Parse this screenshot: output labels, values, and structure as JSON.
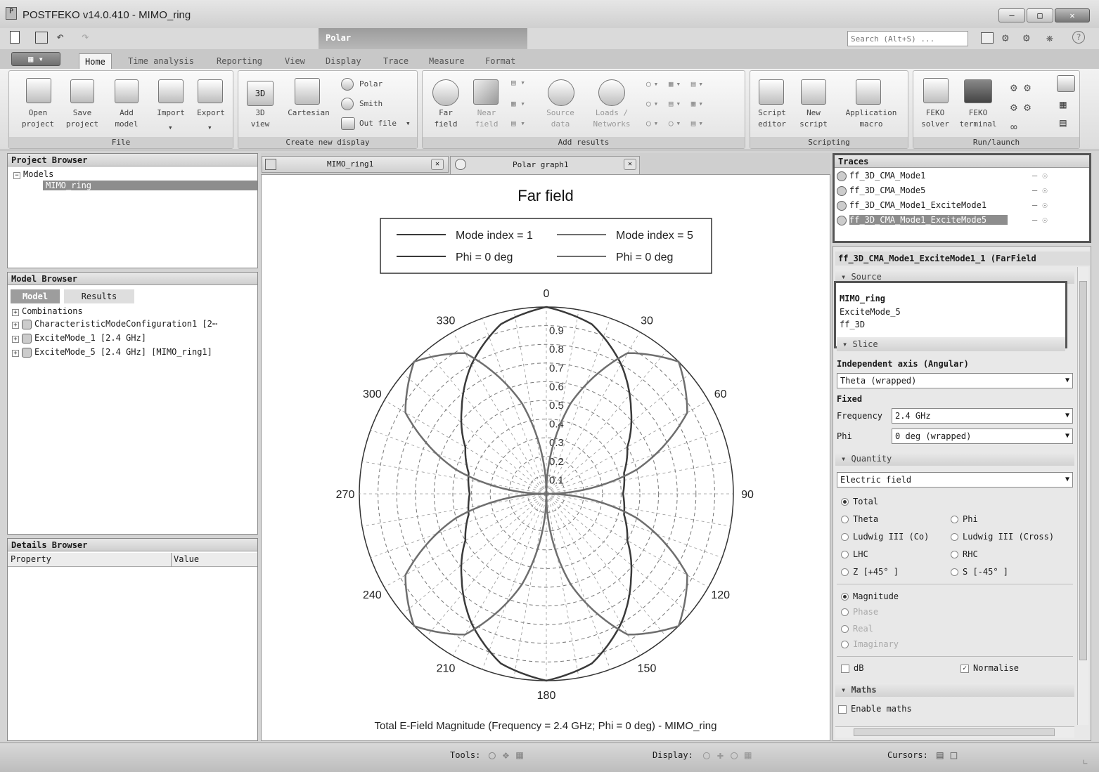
{
  "window": {
    "title": "POSTFEKO v14.0.410 - MIMO_ring",
    "search_placeholder": "Search (Alt+S) ..."
  },
  "contextual_tab": "Polar",
  "tabs": [
    "Home",
    "Time analysis",
    "Reporting",
    "View",
    "Display",
    "Trace",
    "Measure",
    "Format"
  ],
  "ribbon": {
    "file_group": "File",
    "create_group": "Create new display",
    "add_group": "Add results",
    "scripting_group": "Scripting",
    "run_group": "Run/launch",
    "open_project": "Open\nproject",
    "save_project": "Save\nproject",
    "add_model": "Add\nmodel",
    "import": "Import",
    "export": "Export",
    "view3d": "3D\nview",
    "cartesian": "Cartesian",
    "polar": "Polar",
    "smith": "Smith",
    "out_file": "Out file",
    "far_field": "Far\nfield",
    "near_field": "Near\nfield",
    "source_data": "Source\ndata",
    "loads_networks": "Loads /\nNetworks",
    "script_editor": "Script\neditor",
    "new_script": "New\nscript",
    "application_macro": "Application\nmacro",
    "feko_solver": "FEKO\nsolver",
    "feko_terminal": "FEKO\nterminal"
  },
  "project_browser": {
    "title": "Project Browser",
    "root": "Models",
    "child": "MIMO_ring"
  },
  "model_browser": {
    "title": "Model Browser",
    "tab_model": "Model",
    "tab_results": "Results",
    "items": [
      "Combinations",
      "CharacteristicModeConfiguration1 [2⋯",
      "ExciteMode_1 [2.4 GHz]",
      "ExciteMode_5 [2.4 GHz] [MIMO_ring1]"
    ]
  },
  "details_browser": {
    "title": "Details Browser",
    "col_property": "Property",
    "col_value": "Value"
  },
  "doc_tabs": [
    "MIMO_ring1",
    "Polar graph1"
  ],
  "traces": {
    "title": "Traces",
    "items": [
      "ff_3D_CMA_Mode1",
      "ff_3D_CMA_Mode5",
      "ff_3D_CMA_Mode1_ExciteMode1",
      "ff_3D_CMA_Mode1_ExciteMode5"
    ]
  },
  "props": {
    "header": "ff_3D_CMA_Mode1_ExciteMode1_1 (FarField",
    "source_label": "Source",
    "source_lines": [
      "MIMO_ring",
      "ExciteMode_5",
      "ff_3D"
    ],
    "slice_label": "Slice",
    "independent_axis": "Independent axis (Angular)",
    "axis_value": "Theta (wrapped)",
    "fixed": "Fixed",
    "frequency_label": "Frequency",
    "frequency_value": "2.4 GHz",
    "phi_label": "Phi",
    "phi_value": "0 deg (wrapped)",
    "quantity_label": "Quantity",
    "quantity_value": "Electric field",
    "opt_total": "Total",
    "opt_theta": "Theta",
    "opt_phi": "Phi",
    "opt_ludwig_co": "Ludwig III (Co)",
    "opt_ludwig_cross": "Ludwig III (Cross)",
    "opt_lhc": "LHC",
    "opt_rhc": "RHC",
    "opt_z": "Z [+45° ]",
    "opt_s": "S [-45° ]",
    "opt_magnitude": "Magnitude",
    "opt_phase": "Phase",
    "opt_real": "Real",
    "opt_imaginary": "Imaginary",
    "db": "dB",
    "normalise": "Normalise",
    "maths_label": "Maths",
    "enable_maths": "Enable maths"
  },
  "status": {
    "tools": "Tools:",
    "display": "Display:",
    "cursors": "Cursors:"
  },
  "chart_data": {
    "type": "polar",
    "title": "Far field",
    "footer": "Total E-Field Magnitude (Frequency = 2.4 GHz; Phi = 0 deg) - MIMO_ring",
    "angle_ticks": [
      0,
      30,
      60,
      90,
      120,
      150,
      180,
      210,
      240,
      270,
      300,
      330
    ],
    "radial_ticks": [
      0.1,
      0.2,
      0.3,
      0.4,
      0.5,
      0.6,
      0.7,
      0.8,
      0.9
    ],
    "rlim": [
      0,
      1
    ],
    "legend": [
      [
        "Mode index = 1",
        "Mode index = 5"
      ],
      [
        "Phi = 0 deg",
        "Phi = 0 deg"
      ]
    ],
    "series": [
      {
        "name": "Mode index = 1",
        "r": [
          1.0,
          0.94,
          0.8,
          0.64,
          0.5,
          0.43,
          0.41,
          0.43,
          0.5,
          0.64,
          0.8,
          0.94,
          1.0
        ]
      },
      {
        "name": "Mode index = 5",
        "r": [
          0.0,
          0.5,
          0.87,
          1.0,
          0.87,
          0.5,
          0.0,
          0.5,
          0.87,
          1.0,
          0.87,
          0.5,
          0.0
        ]
      }
    ],
    "theta": [
      0,
      15,
      30,
      45,
      60,
      75,
      90,
      105,
      120,
      135,
      150,
      165,
      180
    ],
    "colors": {
      "mode1": "#3a3a3a",
      "mode5": "#6e6e6e"
    }
  }
}
